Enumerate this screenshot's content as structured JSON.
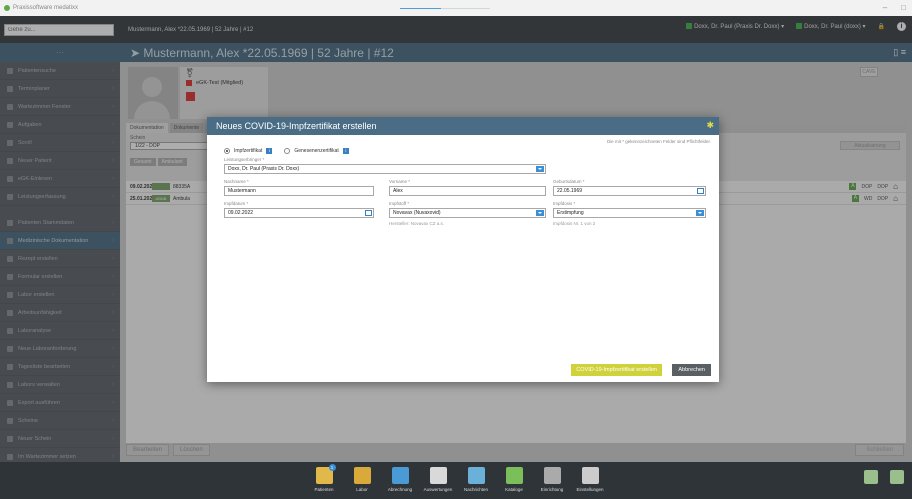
{
  "window": {
    "title": "Praxissoftware medatixx",
    "min_glyph": "–",
    "max_glyph": "□",
    "progress": 0.45
  },
  "topbar": {
    "goto_placeholder": "Gehe zu...",
    "patient_line": "Mustermann, Alex *22.05.1969 | 52 Jahre | #12",
    "practice": "Doxx, Dr. Paul (Praxis Dr. Doxx)",
    "user": "Doxx, Dr. Paul (doxx)",
    "info_glyph": "i"
  },
  "sidebar": {
    "head_glyph": "···",
    "items": [
      {
        "label": "Patientensuche"
      },
      {
        "label": "Terminplaner"
      },
      {
        "label": "Wartezimmer Fenster"
      },
      {
        "label": "Aufgaben"
      },
      {
        "label": "Scroll"
      },
      {
        "label": "Neuer Patient"
      },
      {
        "label": "eGK-Einlesen"
      },
      {
        "label": "Leistungserfassung"
      }
    ],
    "items2": [
      {
        "label": "Patienten Stammdaten"
      },
      {
        "label": "Medizinische Dokumentation",
        "active": true
      },
      {
        "label": "Rezept erstellen"
      },
      {
        "label": "Formular erstellen"
      },
      {
        "label": "Labor erstellen"
      },
      {
        "label": "Arbeitsunfähigkeit"
      },
      {
        "label": "Laboranalyse"
      },
      {
        "label": "Neue Laboranforderung"
      },
      {
        "label": "Tagesliste bearbeiten"
      },
      {
        "label": "Labors verwalten"
      },
      {
        "label": "Export ausführen"
      },
      {
        "label": "Scheine"
      },
      {
        "label": "Neuer Schein"
      },
      {
        "label": "Im Wartezimmer setzen"
      },
      {
        "label": "Abrechnung"
      }
    ]
  },
  "main": {
    "header": "Mustermann, Alex *22.05.1969 | 52 Jahre | #12",
    "header_icons": "▯ ≡",
    "card": {
      "gender_glyph": "⚧",
      "egk_label": "eGK-Test (Mitglied)",
      "small_btn": "CAVE"
    },
    "tabs": [
      "Dokumentation",
      "Dokumente"
    ],
    "filter": {
      "label": "Schein",
      "value": "1/22 - DOP",
      "pills": [
        "Gesamt",
        "Ambulant"
      ],
      "right_button": "Aktualisierung"
    },
    "rows": [
      {
        "date": "09.02.2027",
        "tag": "",
        "text": "88335A",
        "r1": "DOP",
        "r2": "DOP"
      },
      {
        "date": "25.01.2027",
        "tag": "ABNB",
        "text": "Ambula",
        "r1": "WD",
        "r2": "DOP"
      }
    ],
    "footer": {
      "edit": "Bearbeiten",
      "delete": "Löschen",
      "close": "Schließen"
    }
  },
  "dialog": {
    "title": "Neues COVID-19-Impfzertifikat erstellen",
    "star_glyph": "✱",
    "required_note": "Die mit * gekennzeichneten Felder sind Pflichtfelder.",
    "radio_vacc": "Impfzertifikat",
    "radio_recovered": "Genesenenzertifikat",
    "info_glyph": "i",
    "provider_label": "Leistungserbringer *",
    "provider_value": "Doxx, Dr. Paul (Praxis Dr. Doxx)",
    "lastname_label": "Nachname *",
    "lastname_value": "Mustermann",
    "firstname_label": "Vorname *",
    "firstname_value": "Alex",
    "birthdate_label": "Geburtsdatum *",
    "birthdate_value": "22.05.1969",
    "vaccdate_label": "Impfdatum *",
    "vaccdate_value": "09.02.2022",
    "vaccine_label": "Impfstoff *",
    "vaccine_value": "Novavax (Nuvaxovid)",
    "vaccine_hint": "Hersteller: Novavax CZ a.s.",
    "dose_label": "Impfdosis *",
    "dose_value": "Erstimpfung",
    "dose_hint": "Impfdosis Nr. 1 von 2",
    "create_button": "COVID-19-Impfzertifikat erstellen",
    "cancel_button": "Abbrechen"
  },
  "dock": [
    {
      "label": "Patienten",
      "badge": "1",
      "color": "#e1b84a"
    },
    {
      "label": "Labor",
      "color": "#d9a93a"
    },
    {
      "label": "Abrechnung",
      "color": "#4a9ad6"
    },
    {
      "label": "Auswertungen",
      "color": "#d9d9d9"
    },
    {
      "label": "Nachrichten",
      "color": "#6bb0d8"
    },
    {
      "label": "Kataloge",
      "color": "#7bbf5a"
    },
    {
      "label": "Einrichtung",
      "color": "#aaaaaa"
    },
    {
      "label": "Einstellungen",
      "color": "#cccccc"
    }
  ]
}
